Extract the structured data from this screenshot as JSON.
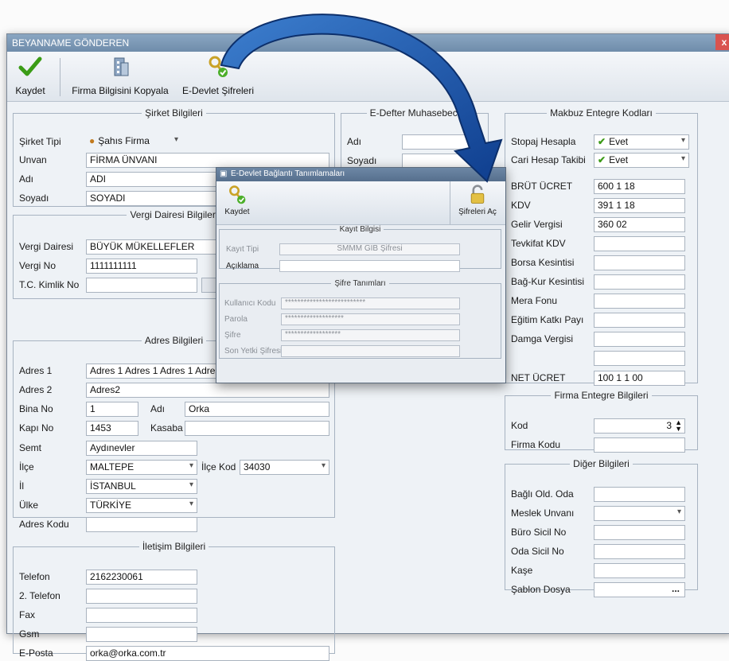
{
  "window": {
    "title": "BEYANNAME GÖNDEREN",
    "close": "x"
  },
  "toolbar": {
    "save": "Kaydet",
    "copy": "Firma Bilgisini Kopyala",
    "edevlet": "E-Devlet Şifreleri"
  },
  "sirket": {
    "legend": "Şirket Bilgileri",
    "tip_label": "Şirket Tipi",
    "tip_value": "Şahıs Firma",
    "unvan_label": "Unvan",
    "unvan_value": "FİRMA ÜNVANI",
    "adi_label": "Adı",
    "adi_value": "ADI",
    "soyadi_label": "Soyadı",
    "soyadi_value": "SOYADI"
  },
  "vergi": {
    "legend": "Vergi Dairesi Bilgileri",
    "daire_label": "Vergi Dairesi",
    "daire_value": "BÜYÜK MÜKELLEFLER",
    "no_label": "Vergi No",
    "no_value": "1111111111",
    "tc_label": "T.C. Kimlik No",
    "tc_value": ""
  },
  "adres": {
    "legend": "Adres Bilgileri",
    "adres1_label": "Adres 1",
    "adres1_value": "Adres 1 Adres 1 Adres 1 Adres 1",
    "adres2_label": "Adres 2",
    "adres2_value": "Adres2",
    "bina_label": "Bina No",
    "bina_value": "1",
    "adi_label": "Adı",
    "adi_value": "Orka",
    "kapi_label": "Kapı No",
    "kapi_value": "1453",
    "kasaba_label": "Kasaba",
    "kasaba_value": "",
    "semt_label": "Semt",
    "semt_value": "Aydınevler",
    "ilce_label": "İlçe",
    "ilce_value": "MALTEPE",
    "ilcekod_label": "İlçe Kod",
    "ilcekod_value": "34030",
    "il_label": "İl",
    "il_value": "İSTANBUL",
    "ulke_label": "Ülke",
    "ulke_value": "TÜRKİYE",
    "kodu_label": "Adres Kodu",
    "kodu_value": ""
  },
  "iletisim": {
    "legend": "İletişim Bilgileri",
    "tel_label": "Telefon",
    "tel_value": "2162230061",
    "tel2_label": "2. Telefon",
    "tel2_value": "",
    "fax_label": "Fax",
    "fax_value": "",
    "gsm_label": "Gsm",
    "gsm_value": "",
    "eposta_label": "E-Posta",
    "eposta_value": "orka@orka.com.tr"
  },
  "edefter": {
    "legend": "E-Defter Muhasebeci",
    "adi_label": "Adı",
    "soyadi_label": "Soyadı"
  },
  "makbuz": {
    "legend": "Makbuz Entegre Kodları",
    "stopaj_label": "Stopaj Hesapla",
    "stopaj_value": "Evet",
    "cari_label": "Cari Hesap Takibi",
    "cari_value": "Evet",
    "rows": [
      {
        "label": "BRÜT ÜCRET",
        "value": "600 1 18"
      },
      {
        "label": "KDV",
        "value": "391 1 18"
      },
      {
        "label": "Gelir Vergisi",
        "value": "360 02"
      },
      {
        "label": "Tevkifat KDV",
        "value": ""
      },
      {
        "label": "Borsa Kesintisi",
        "value": ""
      },
      {
        "label": "Bağ-Kur Kesintisi",
        "value": ""
      },
      {
        "label": "Mera Fonu",
        "value": ""
      },
      {
        "label": "Eğitim Katkı Payı",
        "value": ""
      },
      {
        "label": "Damga Vergisi",
        "value": ""
      },
      {
        "label": "",
        "value": ""
      }
    ],
    "net_label": "NET ÜCRET",
    "net_value": "100 1 1 00"
  },
  "firma": {
    "legend": "Firma Entegre Bilgileri",
    "kod_label": "Kod",
    "kod_value": "3",
    "firmakodu_label": "Firma Kodu",
    "firmakodu_value": ""
  },
  "diger": {
    "legend": "Diğer Bilgileri",
    "rows": [
      {
        "label": "Bağlı Old. Oda",
        "value": ""
      },
      {
        "label": "Meslek Unvanı",
        "value": ""
      },
      {
        "label": "Büro Sicil No",
        "value": ""
      },
      {
        "label": "Oda Sicil No",
        "value": ""
      },
      {
        "label": "Kaşe",
        "value": ""
      },
      {
        "label": "Şablon Dosya",
        "value": ""
      }
    ],
    "browse": "..."
  },
  "popup": {
    "title": "E-Devlet Bağlantı Tanımlamaları",
    "save": "Kaydet",
    "open": "Şifreleri Aç",
    "kayit_legend": "Kayıt Bilgisi",
    "kayittipi_label": "Kayıt Tipi",
    "kayittipi_value": "SMMM GİB Şifresi",
    "aciklama_label": "Açıklama",
    "aciklama_value": "",
    "sifre_legend": "Şifre Tanımları",
    "kullanici_label": "Kullanıcı Kodu",
    "kullanici_value": "**************************",
    "parola_label": "Parola",
    "parola_value": "*******************",
    "sifre_label": "Şifre",
    "sifre_value": "******************",
    "sonyetki_label": "Son Yetki Şifresi",
    "sonyetki_value": ""
  }
}
